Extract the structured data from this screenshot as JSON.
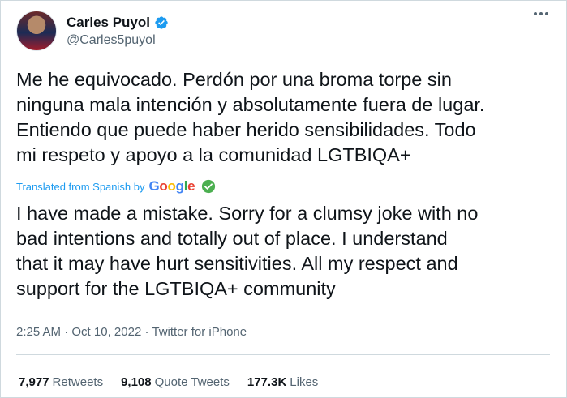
{
  "author": {
    "display_name": "Carles Puyol",
    "handle": "@Carles5puyol"
  },
  "tweet": {
    "original_text": "Me he equivocado. Perdón por una broma torpe sin\nninguna mala intención y absolutamente fuera de lugar.\nEntiendo que puede haber herido sensibilidades. Todo\nmi respeto y apoyo a la comunidad LGTBIQA+",
    "translation_label": "Translated from Spanish by",
    "translation_provider": "Google",
    "translated_text": "I have made a mistake. Sorry for a clumsy joke with no\nbad intentions and totally out of place. I understand\nthat it may have hurt sensitivities. All my respect and\nsupport for the LGTBIQA+ community",
    "time": "2:25 AM",
    "date": "Oct 10, 2022",
    "source": "Twitter for iPhone"
  },
  "stats": {
    "retweets_count": "7,977",
    "retweets_label": "Retweets",
    "quotes_count": "9,108",
    "quotes_label": "Quote Tweets",
    "likes_count": "177.3K",
    "likes_label": "Likes"
  },
  "colors": {
    "accent": "#1d9bf0",
    "verified": "#1d9bf0",
    "check_badge": "#4caf50",
    "secondary_text": "#536471"
  },
  "icons": {
    "verified": "verified-badge-icon",
    "more": "more-options-icon",
    "check": "check-circle-icon"
  }
}
